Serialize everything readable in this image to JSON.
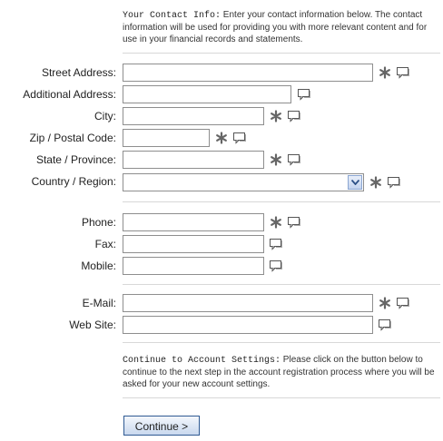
{
  "intro": {
    "title": "Your Contact Info:",
    "text": " Enter your contact information below. The contact information will be used for providing you with more relevant content and for use in your financial records and statements."
  },
  "fields": {
    "street": {
      "label": "Street Address:",
      "value": ""
    },
    "additional": {
      "label": "Additional Address:",
      "value": ""
    },
    "city": {
      "label": "City:",
      "value": ""
    },
    "zip": {
      "label": "Zip / Postal Code:",
      "value": ""
    },
    "state": {
      "label": "State / Province:",
      "value": ""
    },
    "country": {
      "label": "Country / Region:",
      "value": ""
    },
    "phone": {
      "label": "Phone:",
      "value": ""
    },
    "fax": {
      "label": "Fax:",
      "value": ""
    },
    "mobile": {
      "label": "Mobile:",
      "value": ""
    },
    "email": {
      "label": "E-Mail:",
      "value": ""
    },
    "website": {
      "label": "Web Site:",
      "value": ""
    }
  },
  "continue_section": {
    "title": "Continue to Account Settings:",
    "text": " Please click on the button below to continue to the next step in the account registration process where you will be asked for your new account settings."
  },
  "continue_button": {
    "label": "Continue >"
  },
  "icons": {
    "required": "asterisk-icon",
    "help": "speech-bubble-icon"
  },
  "colors": {
    "field_border": "#8e8e8e",
    "button_border": "#2f5a93",
    "divider": "#d8d8d8"
  }
}
